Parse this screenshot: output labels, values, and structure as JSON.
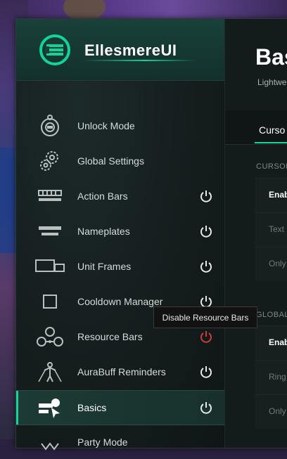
{
  "app": {
    "name": "EllesmereUI",
    "accent": "#12d49a",
    "danger": "#d23a3a"
  },
  "sidebar": {
    "items": [
      {
        "label": "Unlock Mode",
        "icon": "lock-icon",
        "has_power": false,
        "active": false
      },
      {
        "label": "Global Settings",
        "icon": "gears-icon",
        "has_power": false,
        "active": false
      },
      {
        "label": "Action Bars",
        "icon": "action-bars-icon",
        "has_power": true,
        "active": false
      },
      {
        "label": "Nameplates",
        "icon": "nameplates-icon",
        "has_power": true,
        "active": false
      },
      {
        "label": "Unit Frames",
        "icon": "unit-frames-icon",
        "has_power": true,
        "active": false
      },
      {
        "label": "Cooldown Manager",
        "icon": "cooldown-icon",
        "has_power": true,
        "active": false
      },
      {
        "label": "Resource Bars",
        "icon": "resource-bars-icon",
        "has_power": true,
        "active": false,
        "power_state": "hover-red"
      },
      {
        "label": "AuraBuff Reminders",
        "icon": "aura-icon",
        "has_power": true,
        "active": false
      },
      {
        "label": "Basics",
        "icon": "basics-icon",
        "has_power": true,
        "active": true
      },
      {
        "label": "Party Mode",
        "icon": "party-mode-icon",
        "has_power": false,
        "active": false
      }
    ]
  },
  "tooltip": {
    "text": "Disable Resource Bars"
  },
  "main": {
    "title": "Bas",
    "subtitle": "Lightwe",
    "tab_label": "Curso",
    "section1": "CURSOR",
    "section2": "GLOBAL",
    "rows": [
      {
        "text": "Enab",
        "dim": false
      },
      {
        "text": "Text",
        "dim": true
      },
      {
        "text": "Only",
        "dim": true
      },
      {
        "text": "Enab",
        "dim": false
      },
      {
        "text": "Ring",
        "dim": true
      },
      {
        "text": "Only",
        "dim": true
      }
    ]
  }
}
